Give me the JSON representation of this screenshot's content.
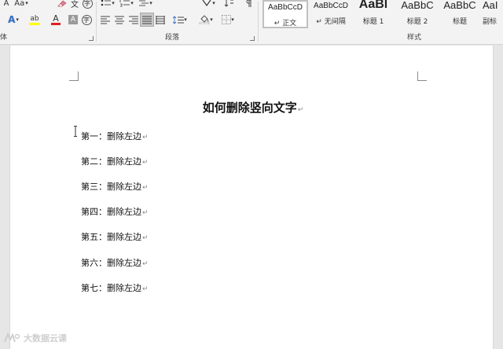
{
  "ribbon": {
    "font_group_label": "体",
    "paragraph_group_label": "段落",
    "styles_group_label": "样式",
    "font_row1": {
      "size_grow_label": "A",
      "case_label": "Aa",
      "clear_format_label": "A",
      "phonetic_label": "文",
      "enclose_label": "字"
    },
    "font_row2": {
      "text_effect_label": "A",
      "highlight_label": "ab",
      "font_color_label": "A",
      "shade_label": "A",
      "enclosed_char_label": "字"
    },
    "highlight_color": "#ffff00",
    "font_color": "#e02020",
    "styles": [
      {
        "preview": "AaBbCcD",
        "name": "↵ 正文",
        "selected": true
      },
      {
        "preview": "AaBbCcD",
        "name": "↵ 无间隔",
        "selected": false
      },
      {
        "preview": "AaBl",
        "name": "标题 1",
        "selected": false
      },
      {
        "preview": "AaBbC",
        "name": "标题 2",
        "selected": false
      },
      {
        "preview": "AaBbC",
        "name": "标题",
        "selected": false
      },
      {
        "preview": "AaI",
        "name": "副标",
        "selected": false
      }
    ]
  },
  "document": {
    "title": "如何删除竖向文字",
    "paragraph_mark": "↵",
    "paragraphs": [
      "第一：删除左边",
      "第二：删除左边",
      "第三：删除左边",
      "第四：删除左边",
      "第五：删除左边",
      "第六：删除左边",
      "第七：删除左边"
    ]
  },
  "watermark": {
    "text": "大数据云课"
  }
}
